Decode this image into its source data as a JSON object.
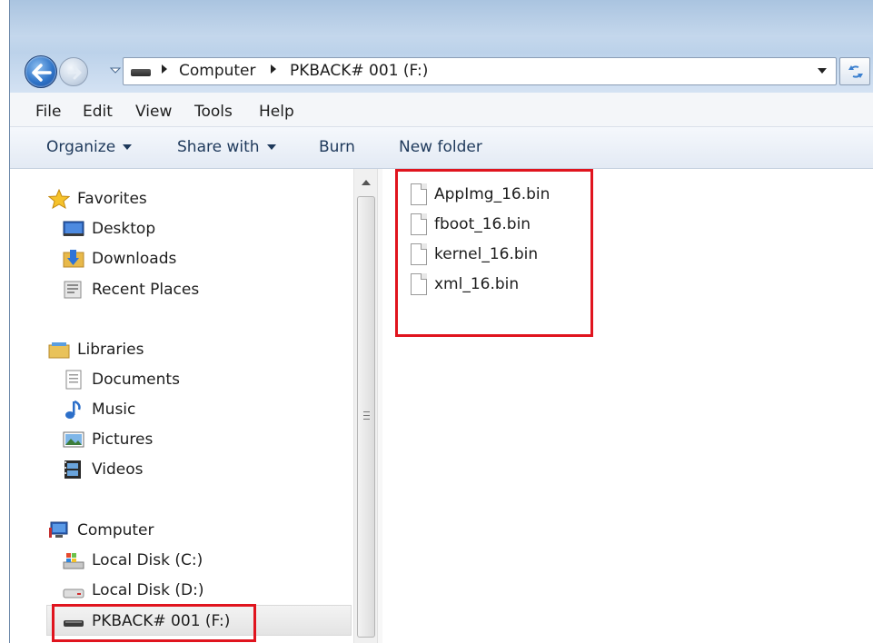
{
  "address_bar": {
    "crumbs": [
      "Computer",
      "PKBACK# 001 (F:)"
    ]
  },
  "menu_bar": {
    "items": [
      "File",
      "Edit",
      "View",
      "Tools",
      "Help"
    ]
  },
  "command_bar": {
    "organize": "Organize",
    "share_with": "Share with",
    "burn": "Burn",
    "new_folder": "New folder"
  },
  "nav_pane": {
    "favorites": {
      "label": "Favorites",
      "items": [
        "Desktop",
        "Downloads",
        "Recent Places"
      ]
    },
    "libraries": {
      "label": "Libraries",
      "items": [
        "Documents",
        "Music",
        "Pictures",
        "Videos"
      ]
    },
    "computer": {
      "label": "Computer",
      "items": [
        "Local Disk (C:)",
        "Local Disk (D:)",
        "PKBACK# 001 (F:)"
      ],
      "selected": "PKBACK# 001 (F:)"
    }
  },
  "files": [
    {
      "name": "AppImg_16.bin"
    },
    {
      "name": "fboot_16.bin"
    },
    {
      "name": "kernel_16.bin"
    },
    {
      "name": "xml_16.bin"
    }
  ],
  "colors": {
    "highlight": "#e0141e",
    "command_text": "#1e395b"
  }
}
